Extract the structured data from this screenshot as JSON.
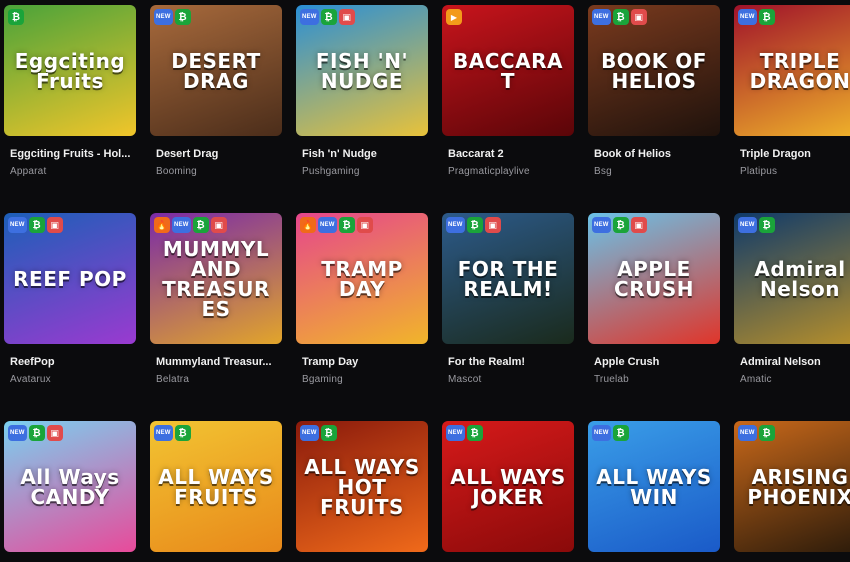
{
  "badge_text": {
    "new": "NEW",
    "btc": "₿",
    "bag": "▣",
    "play": "▶",
    "fire": "🔥"
  },
  "games": [
    {
      "title": "Eggciting Fruits - Hol...",
      "provider": "Apparat",
      "art": "Eggciting Fruits",
      "colors": [
        "#4aa33a",
        "#f1c52a"
      ],
      "badges": [
        "btc"
      ]
    },
    {
      "title": "Desert Drag",
      "provider": "Booming",
      "art": "DESERT DRAG",
      "colors": [
        "#a86a3c",
        "#4b2d1a"
      ],
      "badges": [
        "new",
        "btc"
      ]
    },
    {
      "title": "Fish 'n' Nudge",
      "provider": "Pushgaming",
      "art": "FISH 'N' NUDGE",
      "colors": [
        "#2a8fd6",
        "#e8c23a"
      ],
      "badges": [
        "new",
        "btc",
        "bag"
      ]
    },
    {
      "title": "Baccarat 2",
      "provider": "Pragmaticplaylive",
      "art": "BACCARAT",
      "colors": [
        "#c8141c",
        "#5a0508"
      ],
      "badges": [
        "play"
      ]
    },
    {
      "title": "Book of Helios",
      "provider": "Bsg",
      "art": "BOOK OF HELIOS",
      "colors": [
        "#7a3a1e",
        "#1f120c"
      ],
      "badges": [
        "new",
        "btc",
        "bag"
      ]
    },
    {
      "title": "Triple Dragon",
      "provider": "Platipus",
      "art": "TRIPLE DRAGON",
      "colors": [
        "#a0122a",
        "#f0b42a"
      ],
      "badges": [
        "new",
        "btc"
      ]
    },
    {
      "title": "ReefPop",
      "provider": "Avatarux",
      "art": "REEF POP",
      "colors": [
        "#1c5fb8",
        "#9a3ad0"
      ],
      "badges": [
        "new",
        "btc",
        "bag"
      ]
    },
    {
      "title": "Mummyland Treasur...",
      "provider": "Belatra",
      "art": "MUMMYLAND TREASURES",
      "colors": [
        "#7a2aa8",
        "#e2a52a"
      ],
      "badges": [
        "fire",
        "new",
        "btc",
        "bag"
      ]
    },
    {
      "title": "Tramp Day",
      "provider": "Bgaming",
      "art": "TRAMP DAY",
      "colors": [
        "#e6468c",
        "#f1b52a"
      ],
      "badges": [
        "fire",
        "new",
        "btc",
        "bag"
      ]
    },
    {
      "title": "For the Realm!",
      "provider": "Mascot",
      "art": "FOR THE REALM!",
      "colors": [
        "#2c5a8a",
        "#1a2a1c"
      ],
      "badges": [
        "new",
        "btc",
        "bag"
      ]
    },
    {
      "title": "Apple Crush",
      "provider": "Truelab",
      "art": "APPLE CRUSH",
      "colors": [
        "#6ac2e8",
        "#e0352a"
      ],
      "badges": [
        "new",
        "btc",
        "bag"
      ]
    },
    {
      "title": "Admiral Nelson",
      "provider": "Amatic",
      "art": "Admiral Nelson",
      "colors": [
        "#0f3a6a",
        "#b8902a"
      ],
      "badges": [
        "new",
        "btc"
      ]
    },
    {
      "title": "",
      "provider": "",
      "art": "All Ways CANDY",
      "colors": [
        "#7ad0f0",
        "#e84a9a"
      ],
      "badges": [
        "new",
        "btc",
        "bag"
      ]
    },
    {
      "title": "",
      "provider": "",
      "art": "ALL WAYS FRUITS",
      "colors": [
        "#f2c432",
        "#e8881a"
      ],
      "badges": [
        "new",
        "btc"
      ]
    },
    {
      "title": "",
      "provider": "",
      "art": "ALL WAYS HOT FRUITS",
      "colors": [
        "#8a1a0c",
        "#f06a1a"
      ],
      "badges": [
        "new",
        "btc"
      ]
    },
    {
      "title": "",
      "provider": "",
      "art": "ALL WAYS JOKER",
      "colors": [
        "#d61a1a",
        "#8a0a0a"
      ],
      "badges": [
        "new",
        "btc"
      ]
    },
    {
      "title": "",
      "provider": "",
      "art": "ALL WAYS WIN",
      "colors": [
        "#3a9ee8",
        "#1a5ac8"
      ],
      "badges": [
        "new",
        "btc"
      ]
    },
    {
      "title": "",
      "provider": "",
      "art": "ARISING PHOENIX",
      "colors": [
        "#c8681a",
        "#2a1a0a"
      ],
      "badges": [
        "new",
        "btc"
      ]
    }
  ]
}
